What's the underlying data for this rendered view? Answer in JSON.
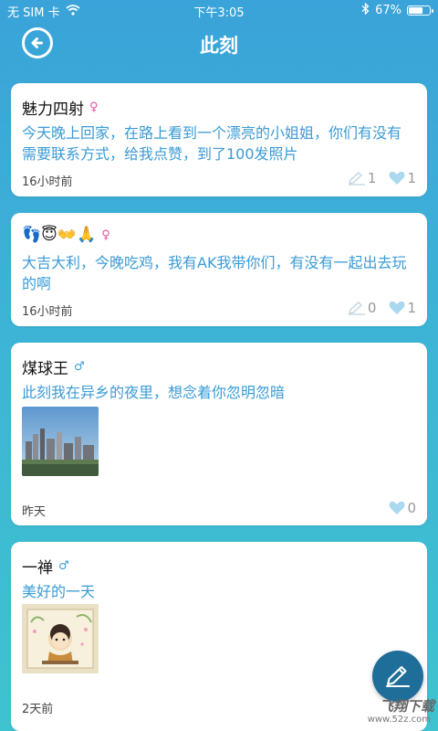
{
  "status_bar": {
    "carrier": "无 SIM 卡",
    "time": "下午3:05",
    "battery_text": "67%",
    "battery_level": 0.67
  },
  "header": {
    "title": "此刻"
  },
  "posts": [
    {
      "username": "魅力四射",
      "gender": "♀",
      "content": "今天晚上回家，在路上看到一个漂亮的小姐姐，你们有没有需要联系方式，给我点赞，到了100发照片",
      "time": "16小时前",
      "comments": "1",
      "likes": "1"
    },
    {
      "username": "👣😇👐🙏",
      "gender": "♀",
      "content": "大吉大利，今晚吃鸡，我有AK我带你们，有没有一起出去玩的啊",
      "time": "16小时前",
      "comments": "0",
      "likes": "1"
    },
    {
      "username": "煤球王",
      "gender": "♂",
      "content": "此刻我在异乡的夜里，想念着你忽明忽暗",
      "time": "昨天",
      "likes": "0"
    },
    {
      "username": "一禅",
      "gender": "♂",
      "content": "美好的一天",
      "time": "2天前"
    }
  ],
  "watermark": {
    "brand": "飞翔下载",
    "site": "www.52z.com"
  },
  "colors": {
    "accent": "#3a9bd6",
    "female": "#e0529c",
    "male": "#3b9bd8",
    "fab": "#1f6e9a"
  },
  "icons": {
    "back": "arrow-left-circle-icon",
    "comment": "pencil-outline-icon",
    "like": "heart-icon",
    "compose": "pencil-icon"
  }
}
